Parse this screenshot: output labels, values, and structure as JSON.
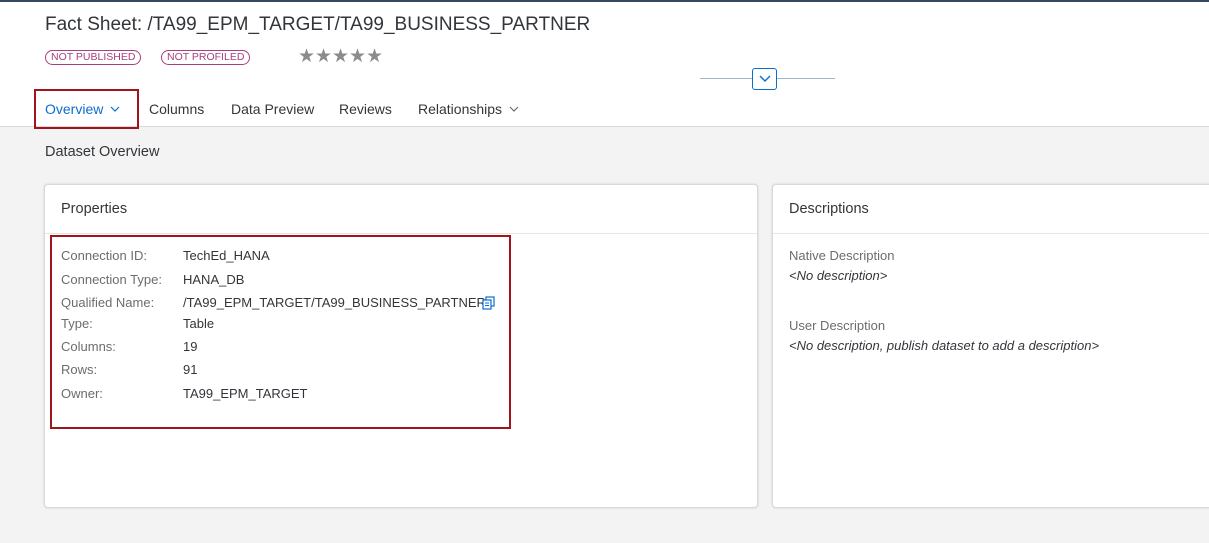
{
  "header": {
    "title": "Fact Sheet: /TA99_EPM_TARGET/TA99_BUSINESS_PARTNER",
    "badges": [
      "NOT PUBLISHED",
      "NOT PROFILED"
    ],
    "rating": {
      "value": 0,
      "max": 5,
      "star_glyph": "★"
    }
  },
  "tabs": [
    {
      "label": "Overview",
      "active": true,
      "has_dropdown": true
    },
    {
      "label": "Columns",
      "active": false,
      "has_dropdown": false
    },
    {
      "label": "Data Preview",
      "active": false,
      "has_dropdown": false
    },
    {
      "label": "Reviews",
      "active": false,
      "has_dropdown": false
    },
    {
      "label": "Relationships",
      "active": false,
      "has_dropdown": true
    }
  ],
  "main": {
    "section_title": "Dataset Overview",
    "properties": {
      "title": "Properties",
      "rows": [
        {
          "label": "Connection ID:",
          "value": "TechEd_HANA"
        },
        {
          "label": "Connection Type:",
          "value": "HANA_DB"
        },
        {
          "label": "Qualified Name:",
          "value": "/TA99_EPM_TARGET/TA99_BUSINESS_PARTNER"
        },
        {
          "label": "Type:",
          "value": "Table"
        },
        {
          "label": "Columns:",
          "value": "19"
        },
        {
          "label": "Rows:",
          "value": "91"
        },
        {
          "label": "Owner:",
          "value": "TA99_EPM_TARGET"
        }
      ]
    },
    "descriptions": {
      "title": "Descriptions",
      "native_label": "Native Description",
      "native_value": "<No description>",
      "user_label": "User Description",
      "user_value": "<No description, publish dataset to add a description>"
    }
  },
  "colors": {
    "accent": "#0a6ed1",
    "badge": "#a93e7c",
    "highlight_border": "#a0141e"
  },
  "icons": [
    "chevron-down-icon",
    "copy-icon",
    "star-icon"
  ]
}
